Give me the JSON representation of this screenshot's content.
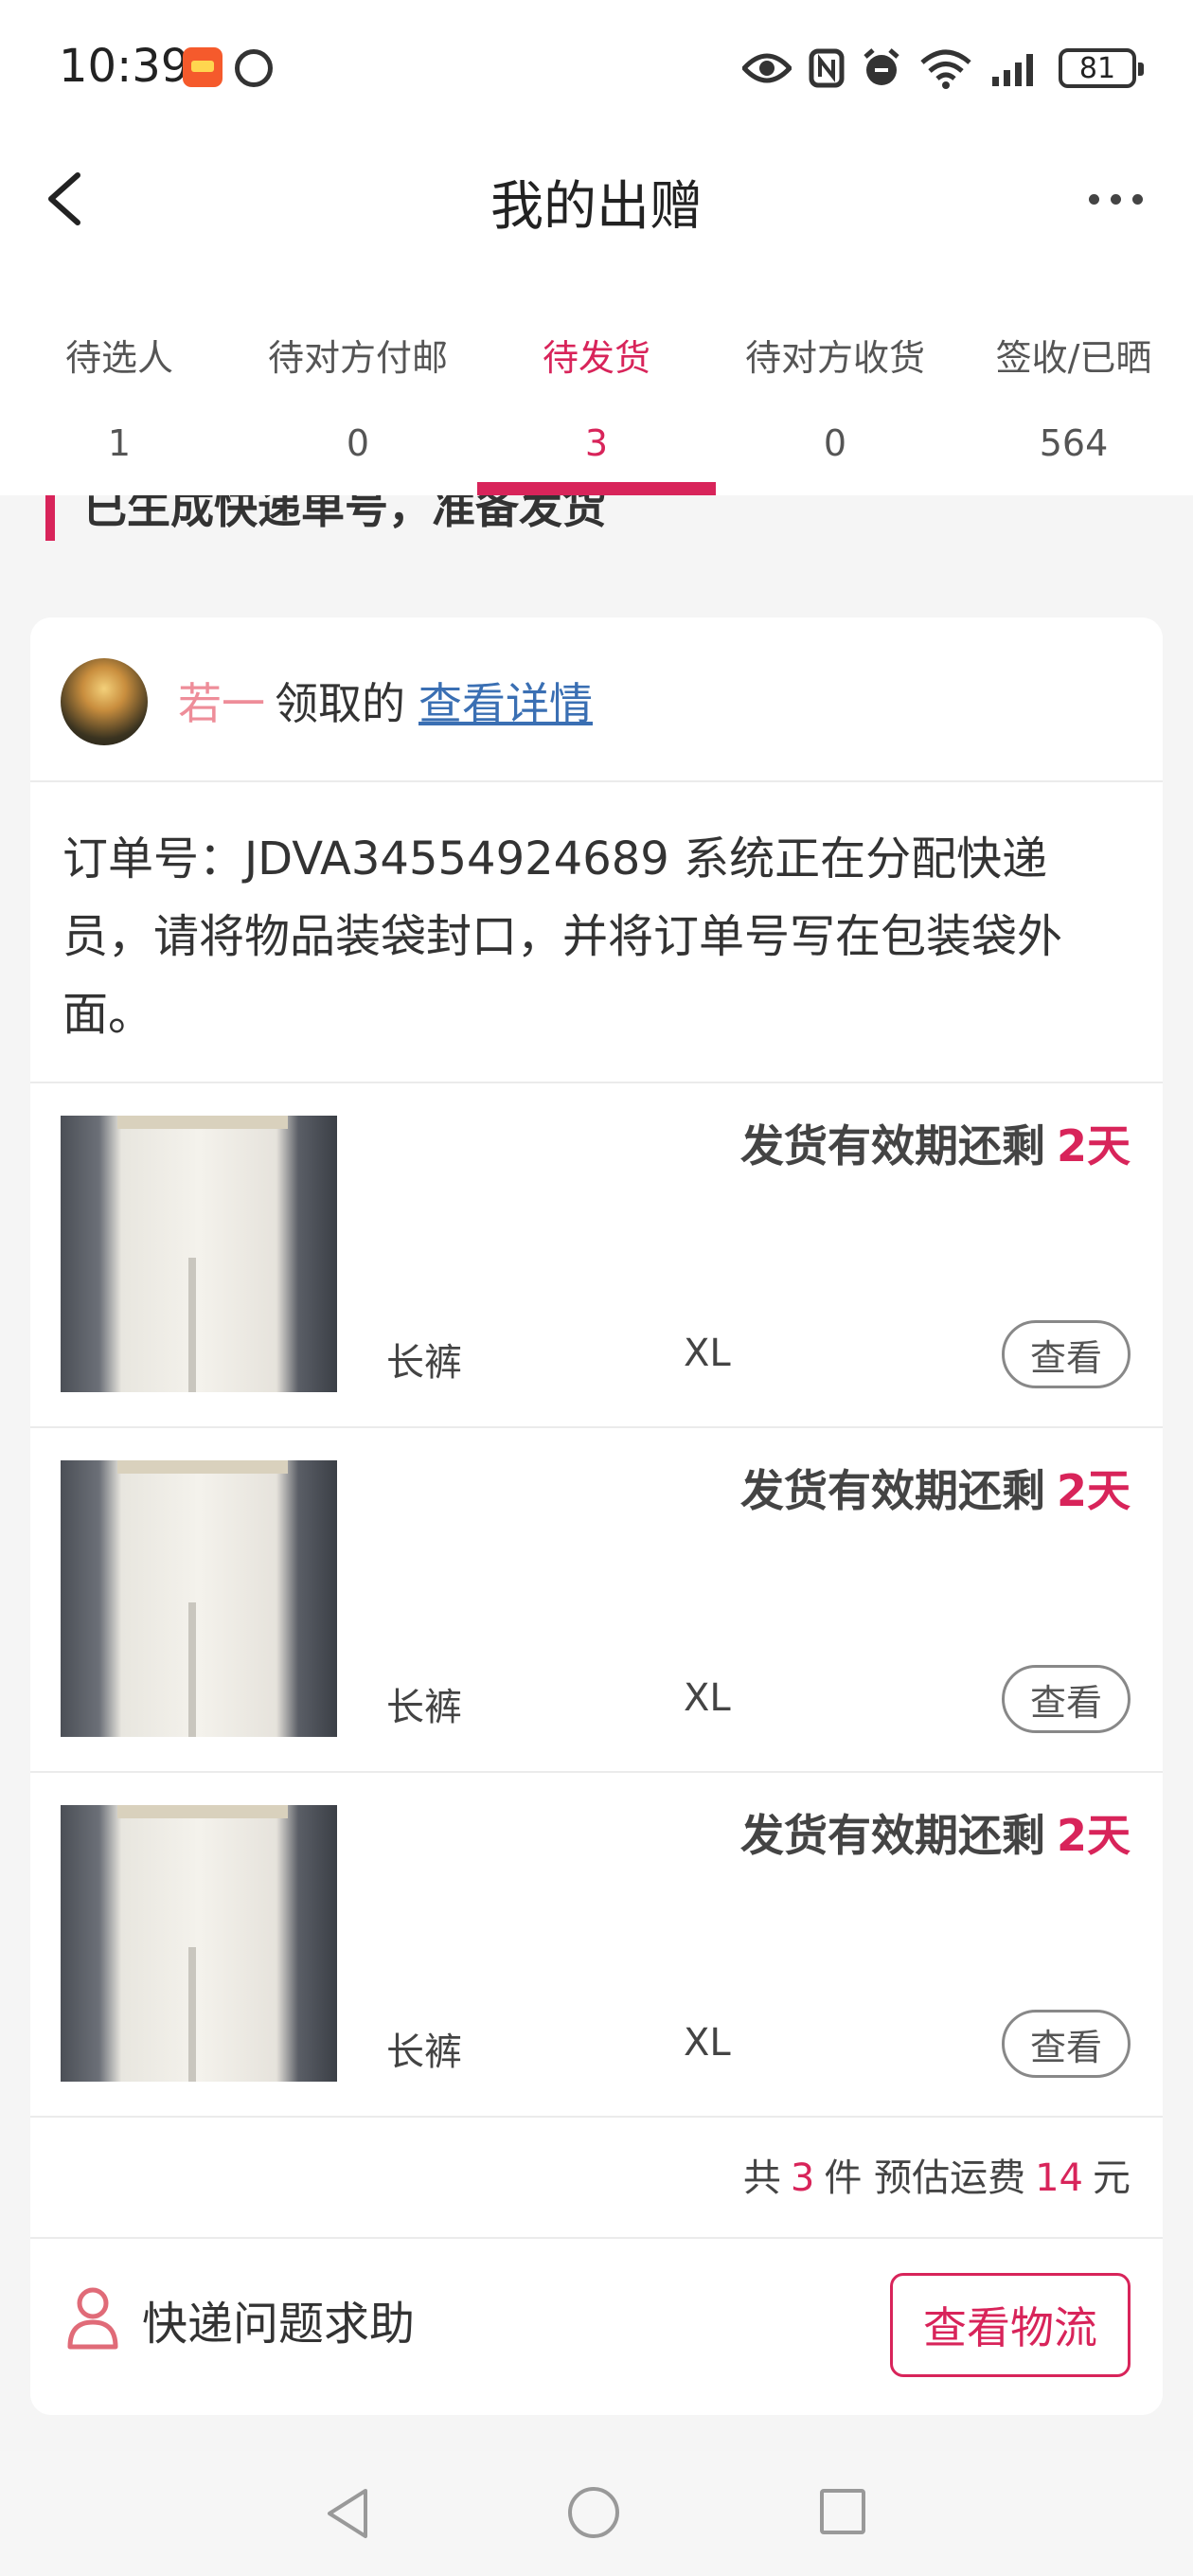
{
  "status_bar": {
    "time": "10:39",
    "battery": "81",
    "icons": [
      "app-notification-icon",
      "app-icon",
      "eye-icon",
      "nfc-icon",
      "alarm-icon",
      "wifi-icon",
      "signal-icon",
      "battery-icon"
    ]
  },
  "header": {
    "title": "我的出赠",
    "back_icon": "chevron-left-icon",
    "more_icon": "more-dots-icon"
  },
  "tabs": [
    {
      "label": "待选人",
      "count": "1"
    },
    {
      "label": "待对方付邮",
      "count": "0"
    },
    {
      "label": "待发货",
      "count": "3",
      "active": true
    },
    {
      "label": "待对方收货",
      "count": "0"
    },
    {
      "label": "签收/已晒",
      "count": "564"
    }
  ],
  "section": {
    "title": "已生成快递单号，准备发货"
  },
  "card": {
    "receiver_name": "若一",
    "receiver_action": "领取的",
    "detail_link": "查看详情",
    "order_text": "订单号：JDVA34554924689 系统正在分配快递员，请将物品装袋封口，并将订单号写在包装袋外面。",
    "items": [
      {
        "deadline_label": "发货有效期还剩",
        "deadline_days": "2天",
        "name": "长裤",
        "size": "XL",
        "view_label": "查看"
      },
      {
        "deadline_label": "发货有效期还剩",
        "deadline_days": "2天",
        "name": "长裤",
        "size": "XL",
        "view_label": "查看"
      },
      {
        "deadline_label": "发货有效期还剩",
        "deadline_days": "2天",
        "name": "长裤",
        "size": "XL",
        "view_label": "查看"
      }
    ],
    "summary": {
      "prefix": "共",
      "count": "3",
      "count_unit": "件 预估运费",
      "fee": "14",
      "fee_unit": "元"
    },
    "help_text": "快递问题求助",
    "logistics_button": "查看物流"
  },
  "colors": {
    "accent": "#d8245a",
    "receiver_name": "#ee8d99",
    "link": "#3a6fb3"
  }
}
